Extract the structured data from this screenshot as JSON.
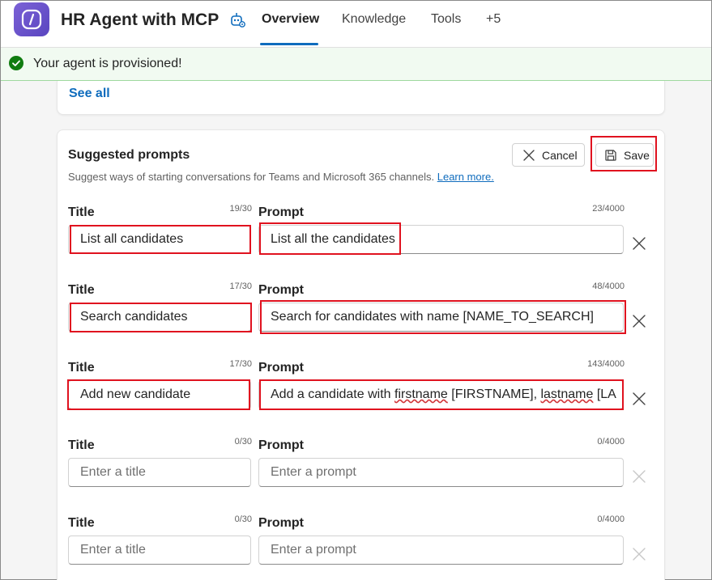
{
  "header": {
    "title": "HR Agent with MCP",
    "tabs": [
      {
        "label": "Overview",
        "active": true
      },
      {
        "label": "Knowledge",
        "active": false
      },
      {
        "label": "Tools",
        "active": false
      },
      {
        "label": "+5",
        "active": false
      }
    ]
  },
  "banner": {
    "text": "Your agent is provisioned!",
    "status_color": "#107c10"
  },
  "knowledge_card": {
    "see_all_label": "See all"
  },
  "suggested_prompts": {
    "title": "Suggested prompts",
    "description": "Suggest ways of starting conversations for Teams and Microsoft 365 channels.",
    "learn_more_label": "Learn more.",
    "cancel_label": "Cancel",
    "save_label": "Save",
    "title_label": "Title",
    "prompt_label": "Prompt",
    "title_placeholder": "Enter a title",
    "prompt_placeholder": "Enter a prompt",
    "rows": [
      {
        "title": "List all candidates",
        "title_count": "19/30",
        "prompt": "List all the candidates",
        "prompt_count": "23/4000"
      },
      {
        "title": "Search candidates",
        "title_count": "17/30",
        "prompt": "Search for candidates with name [NAME_TO_SEARCH]",
        "prompt_count": "48/4000"
      },
      {
        "title": "Add new candidate",
        "title_count": "17/30",
        "prompt_parts": [
          "Add a candidate with ",
          "firstname",
          " [FIRSTNAME], ",
          "lastname",
          " [LA"
        ],
        "prompt_count": "143/4000"
      },
      {
        "title": "",
        "title_count": "0/30",
        "prompt": "",
        "prompt_count": "0/4000"
      },
      {
        "title": "",
        "title_count": "0/30",
        "prompt": "",
        "prompt_count": "0/4000"
      }
    ]
  },
  "colors": {
    "accent": "#0f6cbd",
    "highlight": "#e0121f",
    "brand": "#6b54cf"
  }
}
